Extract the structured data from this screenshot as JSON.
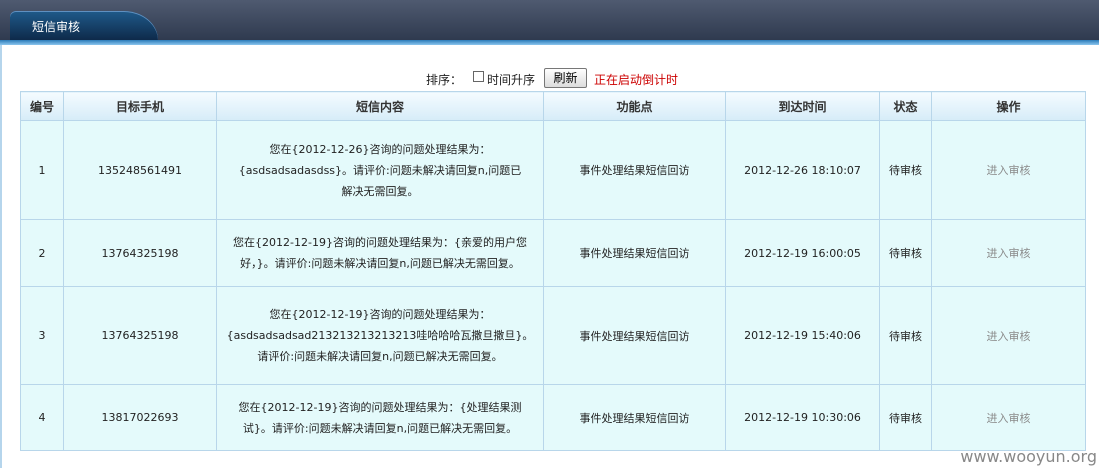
{
  "tab": {
    "title": "短信审核"
  },
  "controls": {
    "sort_label": "排序：",
    "time_asc_label": "时间升序",
    "refresh_label": "刷新",
    "countdown_text": "正在启动倒计时"
  },
  "table": {
    "headers": [
      "编号",
      "目标手机",
      "短信内容",
      "功能点",
      "到达时间",
      "状态",
      "操作"
    ],
    "rows": [
      {
        "id": "1",
        "phone": "135248561491",
        "content_lines": [
          "您在{2012-12-26}咨询的问题处理结果为：",
          "{asdsadsadasdss}。请评价:问题未解决请回复n,问题已",
          "解决无需回复。"
        ],
        "feature": "事件处理结果短信回访",
        "time": "2012-12-26 18:10:07",
        "status": "待审核",
        "action": "进入审核"
      },
      {
        "id": "2",
        "phone": "13764325198",
        "content_lines": [
          "您在{2012-12-19}咨询的问题处理结果为：{亲爱的用户您",
          "好，}。请评价:问题未解决请回复n,问题已解决无需回复。"
        ],
        "feature": "事件处理结果短信回访",
        "time": "2012-12-19 16:00:05",
        "status": "待审核",
        "action": "进入审核"
      },
      {
        "id": "3",
        "phone": "13764325198",
        "content_lines": [
          "您在{2012-12-19}咨询的问题处理结果为：",
          "{asdsadsadsad213213213213213哇哈哈哈瓦撒旦撒旦}。",
          "请评价:问题未解决请回复n,问题已解决无需回复。"
        ],
        "feature": "事件处理结果短信回访",
        "time": "2012-12-19 15:40:06",
        "status": "待审核",
        "action": "进入审核"
      },
      {
        "id": "4",
        "phone": "13817022693",
        "content_lines": [
          "您在{2012-12-19}咨询的问题处理结果为：{处理结果测",
          "试}。请评价:问题未解决请回复n,问题已解决无需回复。"
        ],
        "feature": "事件处理结果短信回访",
        "time": "2012-12-19 10:30:06",
        "status": "待审核",
        "action": "进入审核"
      }
    ]
  },
  "watermark": "www.wooyun.org"
}
